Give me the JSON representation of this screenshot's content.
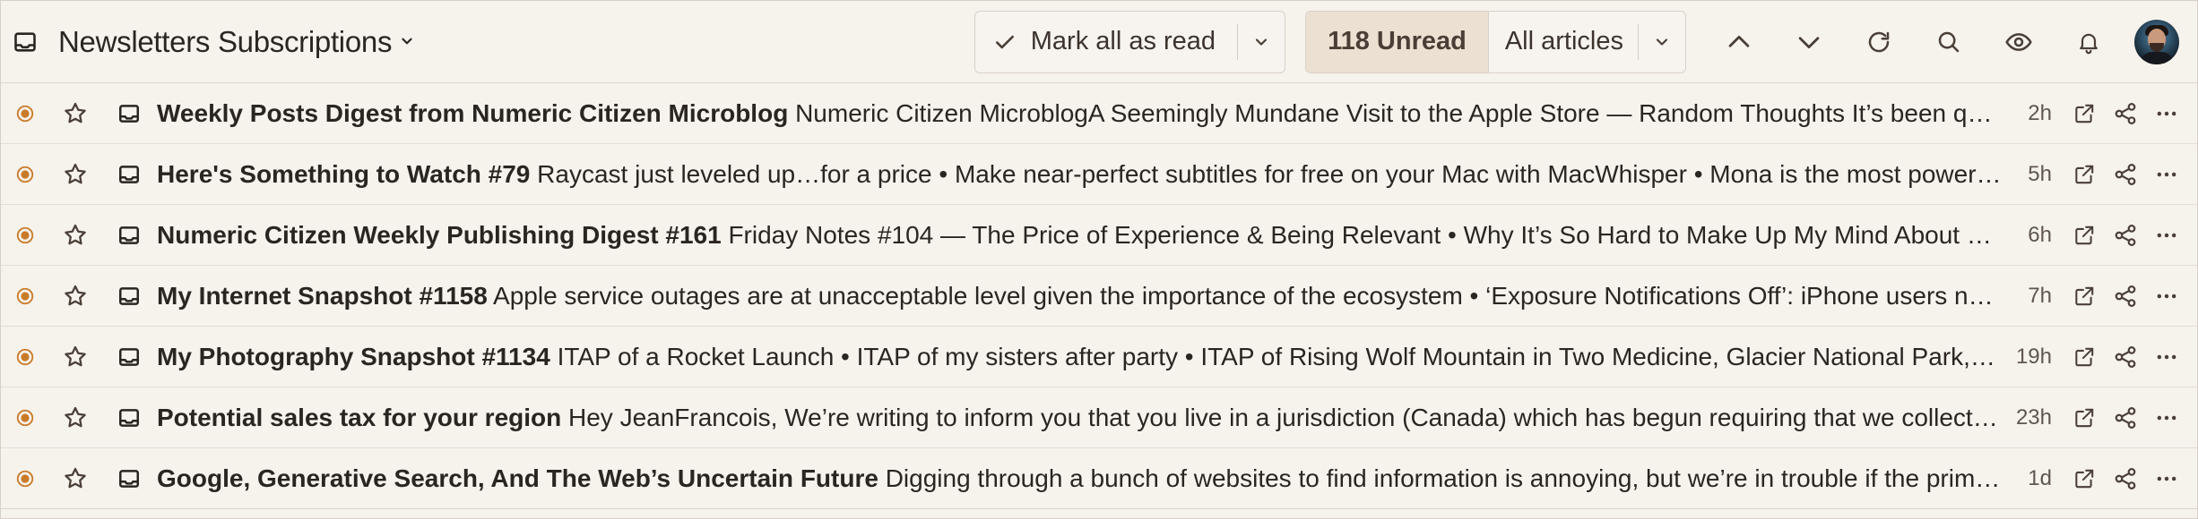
{
  "header": {
    "title": "Newsletters Subscriptions",
    "mark_all_read_label": "Mark all as read",
    "unread_count_label": "118 Unread",
    "filter_label": "All articles"
  },
  "articles": [
    {
      "subject": "Weekly Posts Digest from Numeric Citizen Microblog",
      "summary": "Numeric Citizen MicroblogA Seemingly Mundane Visit to the Apple Store — Random Thoughts It’s been quite a while since I’ve been to an Apple Store",
      "age": "2h"
    },
    {
      "subject": "Here's Something to Watch #79",
      "summary": "Raycast just leveled up…for a price • Make near-perfect subtitles for free on your Mac with MacWhisper • Mona is the most powerful Mastodon client",
      "age": "5h"
    },
    {
      "subject": "Numeric Citizen Weekly Publishing Digest #161",
      "summary": "Friday Notes #104 — The Price of Experience & Being Relevant • Why It’s So Hard to Make Up My Mind About Digital Photography",
      "age": "6h"
    },
    {
      "subject": "My Internet Snapshot #1158",
      "summary": "Apple service outages are at unacceptable level given the importance of the ecosystem • ‘Exposure Notifications Off’: iPhone users notified",
      "age": "7h"
    },
    {
      "subject": "My Photography Snapshot #1134",
      "summary": "ITAP of a Rocket Launch • ITAP of my sisters after party • ITAP of Rising Wolf Mountain in Two Medicine, Glacier National Park, Montana",
      "age": "19h"
    },
    {
      "subject": "Potential sales tax for your region",
      "summary": "Hey JeanFrancois, We’re writing to inform you that you live in a jurisdiction (Canada) which has begun requiring that we collect sales tax",
      "age": "23h"
    },
    {
      "subject": "Google, Generative Search, And The Web’s Uncertain Future",
      "summary": "Digging through a bunch of websites to find information is annoying, but we’re in trouble if the primary source of information disappears",
      "age": "1d"
    }
  ],
  "colors": {
    "accent": "#c97b2a",
    "background": "#f6f2ec",
    "unread_badge_bg": "#ece0d2"
  },
  "icons": {
    "feed": "inbox-tray-icon",
    "chevron": "chevron-down-icon",
    "check": "checkmark-icon",
    "up": "chevron-up-icon",
    "down": "chevron-down-icon",
    "refresh": "refresh-icon",
    "search": "search-icon",
    "view": "eye-icon",
    "notify": "bell-icon",
    "unread": "unread-dot-icon",
    "star": "star-icon",
    "open": "external-link-icon",
    "share": "share-icon",
    "more": "more-horizontal-icon"
  }
}
